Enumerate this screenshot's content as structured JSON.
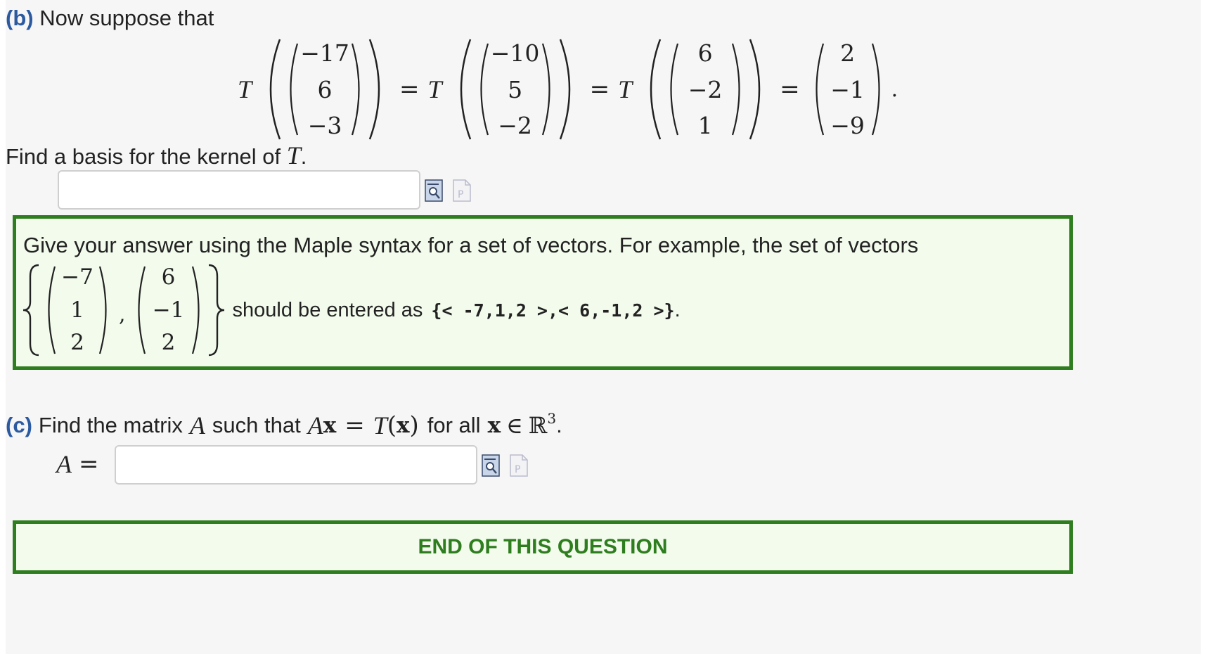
{
  "part_b": {
    "label": "(b)",
    "intro": "Now suppose that",
    "equation": {
      "T": "T",
      "equals": "=",
      "period": ".",
      "v1": [
        "−17",
        "6",
        "−3"
      ],
      "v2": [
        "−10",
        "5",
        "−2"
      ],
      "v3": [
        "6",
        "−2",
        "1"
      ],
      "result": [
        "2",
        "−1",
        "−9"
      ]
    },
    "prompt_pre": "Find a basis for the kernel of ",
    "prompt_T": "T",
    "prompt_post": ".",
    "answer_value": ""
  },
  "hint": {
    "text": "Give your answer using the Maple syntax for a set of vectors. For example, the set of vectors",
    "example_v1": [
      "−7",
      "1",
      "2"
    ],
    "example_v2": [
      "6",
      "−1",
      "2"
    ],
    "comma": ",",
    "entered_as": "should be entered as",
    "code": "{< -7,1,2 >,< 6,-1,2 >}",
    "period": "."
  },
  "part_c": {
    "label": "(c)",
    "t1": "Find the matrix",
    "A": "A",
    "t2": "such that",
    "Ax_A": "A",
    "Ax_x": "x",
    "eq": "=",
    "T": "T",
    "paren_open": "(",
    "x": "x",
    "paren_close": ")",
    "t3": "for all",
    "x2": "x",
    "in": "∈",
    "R": "ℝ",
    "exp": "3",
    "period": ".",
    "A_label": "A",
    "A_eq": "=",
    "answer_value": ""
  },
  "end": {
    "text": "END OF THIS QUESTION"
  },
  "colors": {
    "part_label": "#2c5aa0",
    "green_border": "#2e7d1e",
    "green_bg": "#f2fbec",
    "end_text": "#2e7d1e"
  },
  "icons": {
    "preview": "preview-magnifier-icon",
    "maple": "maple-paste-icon"
  }
}
